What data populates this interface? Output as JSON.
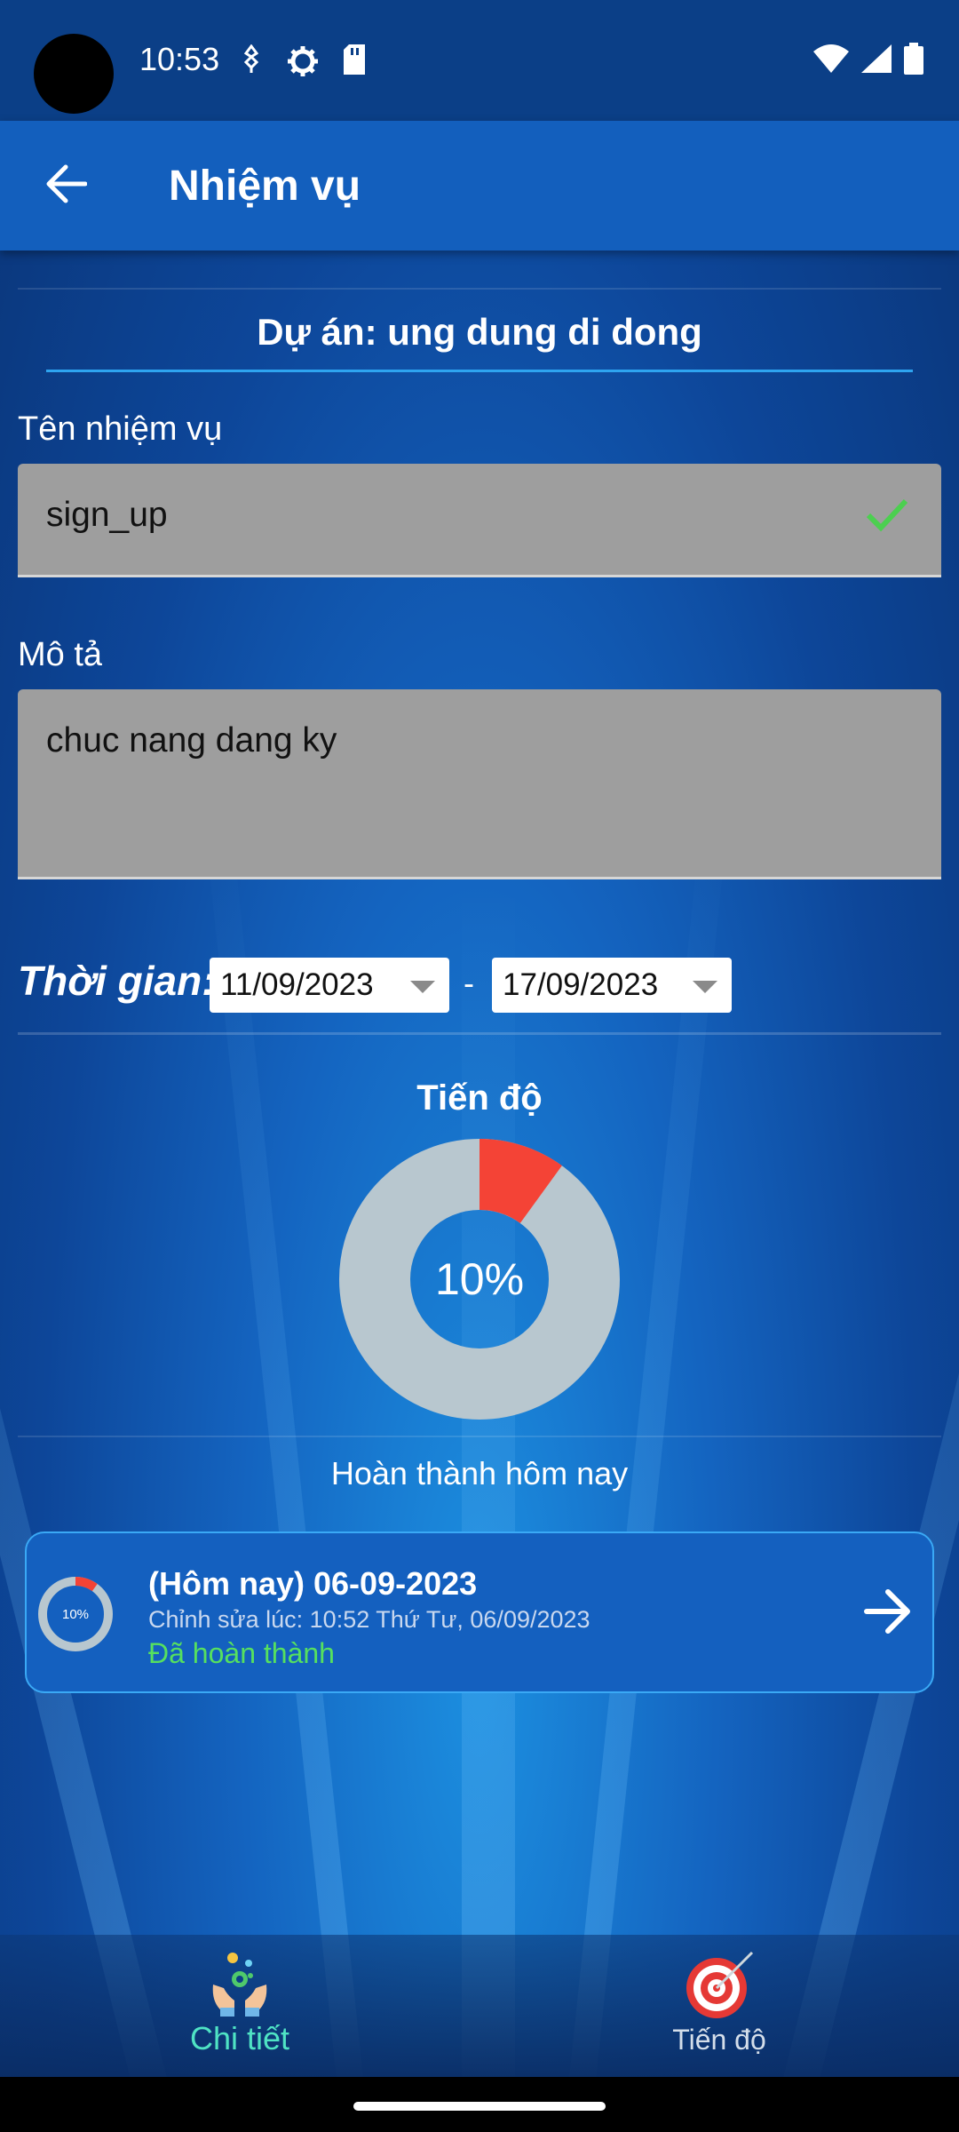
{
  "status_bar": {
    "time": "10:53"
  },
  "app_bar": {
    "title": "Nhiệm vụ",
    "back_icon": "arrow-back-icon"
  },
  "project": {
    "title": "Dự án: ung dung di dong"
  },
  "task_name": {
    "label": "Tên nhiệm vụ",
    "value": "sign_up",
    "valid_icon": "check-icon"
  },
  "description": {
    "label": "Mô tả",
    "value": "chuc nang dang ky"
  },
  "time_range": {
    "label": "Thời gian:",
    "start": "11/09/2023",
    "separator": "-",
    "end": "17/09/2023"
  },
  "progress": {
    "title": "Tiến độ",
    "percent_text": "10%",
    "percent": 10,
    "today_label": "Hoàn thành hôm nay"
  },
  "day_entry": {
    "date": "(Hôm nay) 06-09-2023",
    "edited": "Chỉnh sửa lúc: 10:52 Thứ Tư, 06/09/2023",
    "status": "Đã hoàn thành",
    "percent_text": "10%",
    "percent": 10
  },
  "bottom_nav": {
    "items": [
      {
        "label": "Chi tiết",
        "icon": "hands-gear-icon",
        "active": true
      },
      {
        "label": "Tiến độ",
        "icon": "target-icon",
        "active": false
      }
    ]
  },
  "colors": {
    "progress_done": "#f44336",
    "progress_remaining": "#b8c7cf",
    "active_nav": "#4fe3c4",
    "status_done": "#56e05f"
  }
}
